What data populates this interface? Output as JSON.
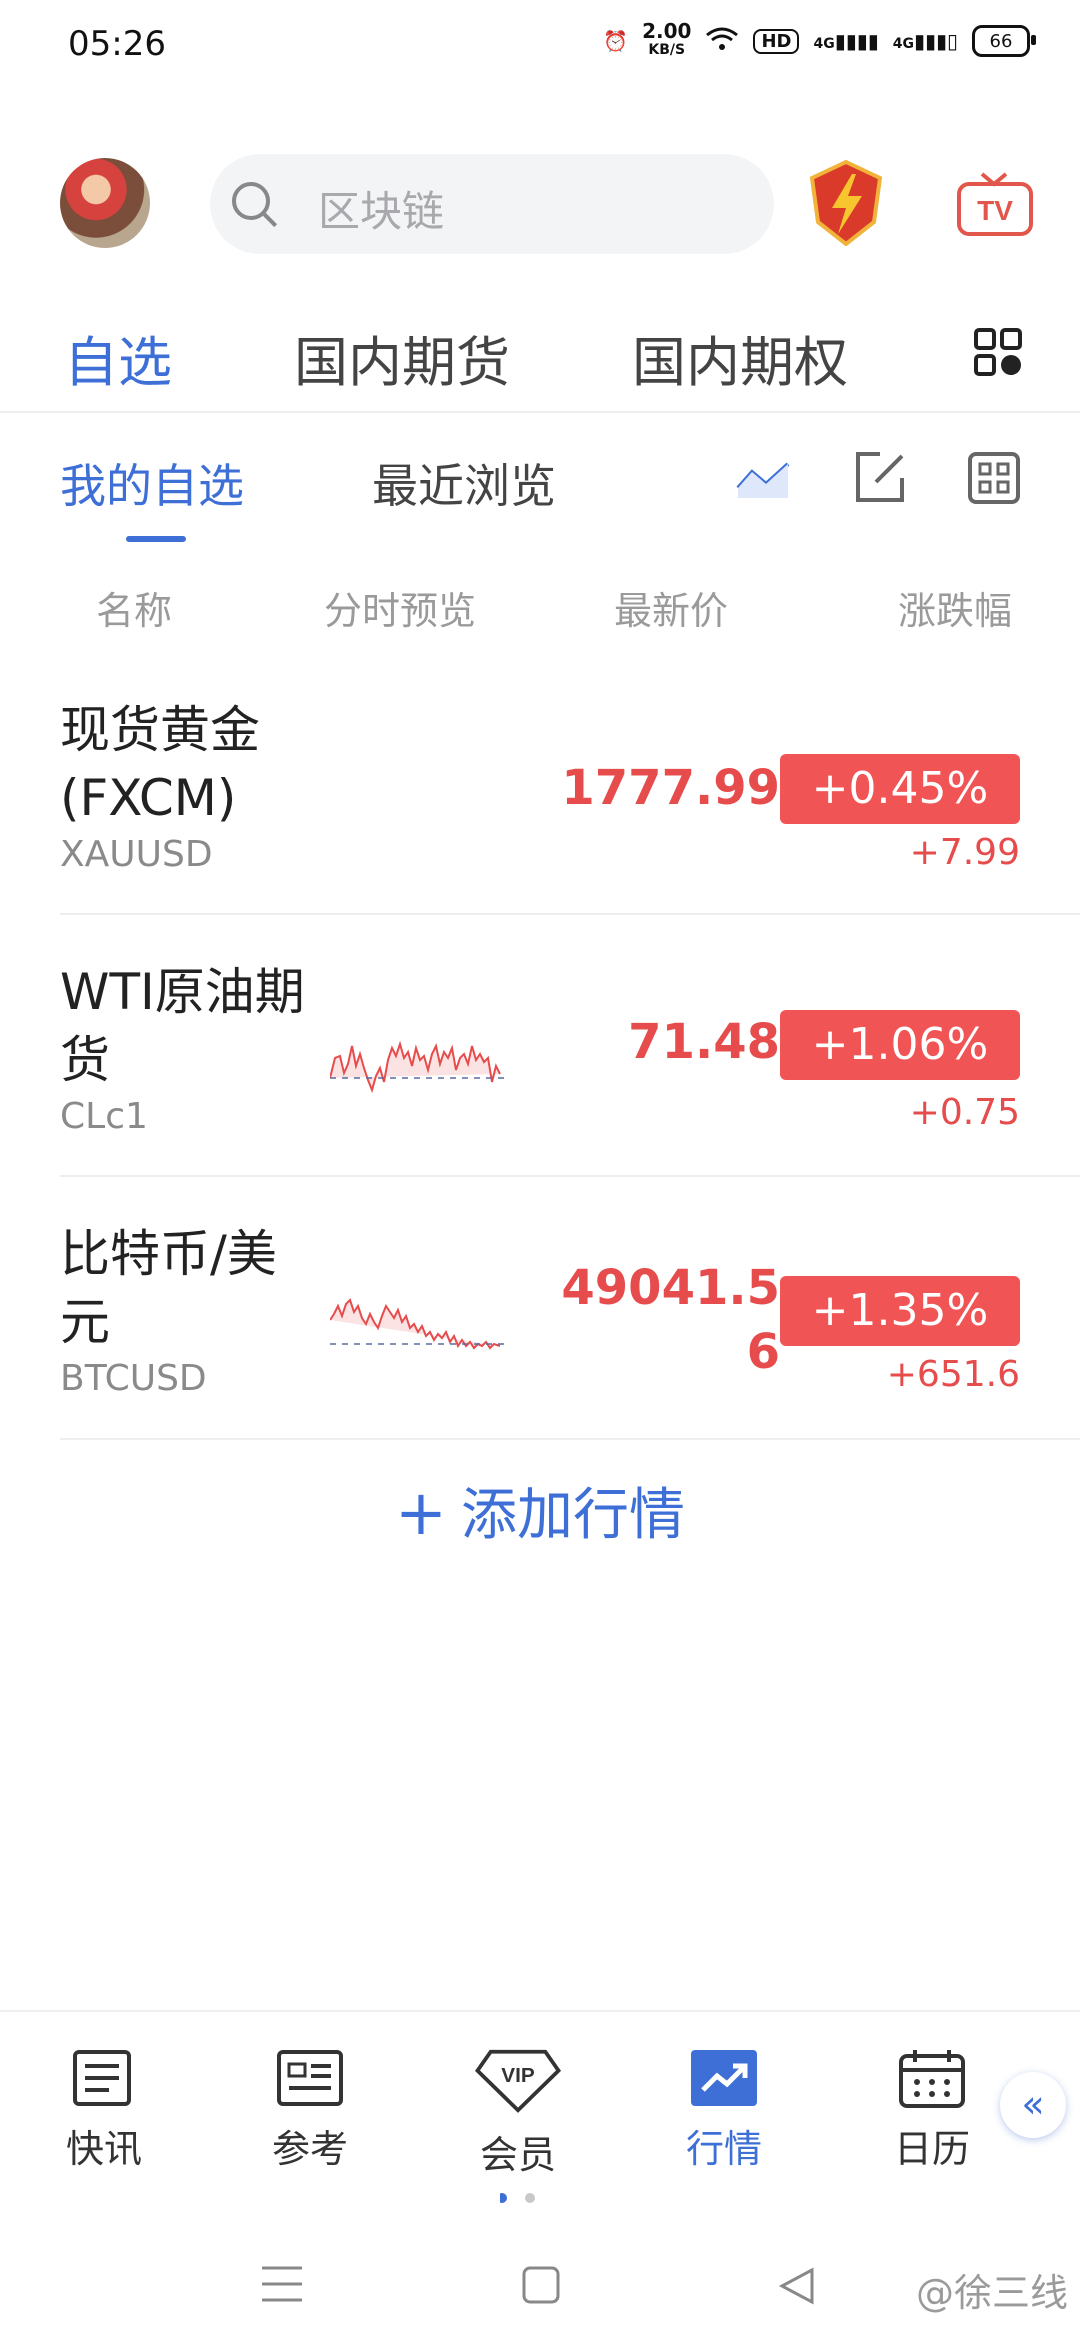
{
  "status": {
    "time": "05:26",
    "speed_value": "2.00",
    "speed_unit": "KB/S",
    "hd": "HD",
    "sig1": "4G",
    "sig2": "4G",
    "battery": "66"
  },
  "header": {
    "search_placeholder": "区块链"
  },
  "main_tabs": [
    "自选",
    "国内期货",
    "国内期权"
  ],
  "sub_tabs": [
    "我的自选",
    "最近浏览"
  ],
  "columns": [
    "名称",
    "分时预览",
    "最新价",
    "涨跌幅"
  ],
  "rows": [
    {
      "name": "现货黄金(FXCM)",
      "code": "XAUUSD",
      "price": "1777.99",
      "pct": "+0.45%",
      "chg": "+7.99"
    },
    {
      "name": "WTI原油期货",
      "code": "CLc1",
      "price": "71.48",
      "pct": "+1.06%",
      "chg": "+0.75"
    },
    {
      "name": "比特币/美元",
      "code": "BTCUSD",
      "price": "49041.56",
      "pct": "+1.35%",
      "chg": "+651.6"
    }
  ],
  "add_label": "添加行情",
  "nav": [
    "快讯",
    "参考",
    "会员",
    "行情",
    "日历"
  ],
  "vip_text": "VIP",
  "tv_text": "TV",
  "watermark": "@徐三线",
  "colors": {
    "accent": "#3d6fd6",
    "up": "#e74c4c",
    "badge": "#f05454"
  }
}
